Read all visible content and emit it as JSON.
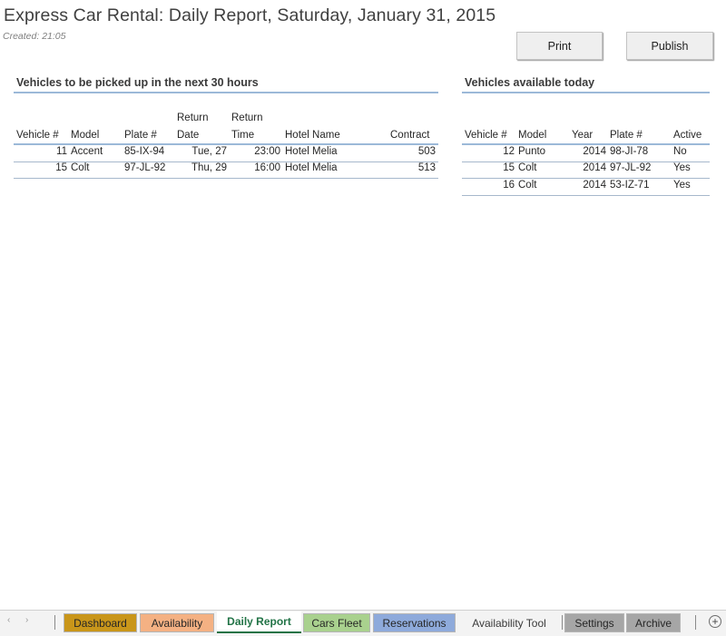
{
  "report": {
    "title": "Express Car Rental: Daily Report, Saturday, January 31, 2015",
    "created": "Created: 21:05"
  },
  "buttons": {
    "print": "Print",
    "publish": "Publish"
  },
  "pickups": {
    "title": "Vehicles to be picked up in the next 30 hours",
    "headers": {
      "vehicle": "Vehicle #",
      "model": "Model",
      "plate": "Plate #",
      "return_date_1": "Return",
      "return_date_2": "Date",
      "return_time_1": "Return",
      "return_time_2": "Time",
      "hotel": "Hotel Name",
      "contract": "Contract"
    },
    "rows": [
      {
        "vehicle": "11",
        "model": "Accent",
        "plate": "85-IX-94",
        "date": "Tue, 27",
        "time": "23:00",
        "hotel": "Hotel Melia",
        "contract": "503"
      },
      {
        "vehicle": "15",
        "model": "Colt",
        "plate": "97-JL-92",
        "date": "Thu, 29",
        "time": "16:00",
        "hotel": "Hotel Melia",
        "contract": "513"
      }
    ]
  },
  "available": {
    "title": "Vehicles available today",
    "headers": {
      "vehicle": "Vehicle #",
      "model": "Model",
      "year": "Year",
      "plate": "Plate #",
      "active": "Active"
    },
    "rows": [
      {
        "vehicle": "12",
        "model": "Punto",
        "year": "2014",
        "plate": "98-JI-78",
        "active": "No"
      },
      {
        "vehicle": "15",
        "model": "Colt",
        "year": "2014",
        "plate": "97-JL-92",
        "active": "Yes"
      },
      {
        "vehicle": "16",
        "model": "Colt",
        "year": "2014",
        "plate": "53-IZ-71",
        "active": "Yes"
      }
    ]
  },
  "sheet_tabs": [
    {
      "label": "Dashboard",
      "color": "#c9961a"
    },
    {
      "label": "Availability",
      "color": "#f4b183"
    },
    {
      "label": "Daily Report",
      "color": "#ffffff",
      "active": true
    },
    {
      "label": "Cars Fleet",
      "color": "#a9d18e"
    },
    {
      "label": "Reservations",
      "color": "#8eaadb"
    },
    {
      "label": "Availability Tool",
      "color": ""
    },
    {
      "label": "Settings",
      "color": "#a6a6a6"
    },
    {
      "label": "Archive",
      "color": "#a6a6a6"
    }
  ],
  "icons": {
    "prev_sheet": "chevron-left-icon",
    "next_sheet": "chevron-right-icon",
    "add_sheet": "plus-circle-icon"
  }
}
